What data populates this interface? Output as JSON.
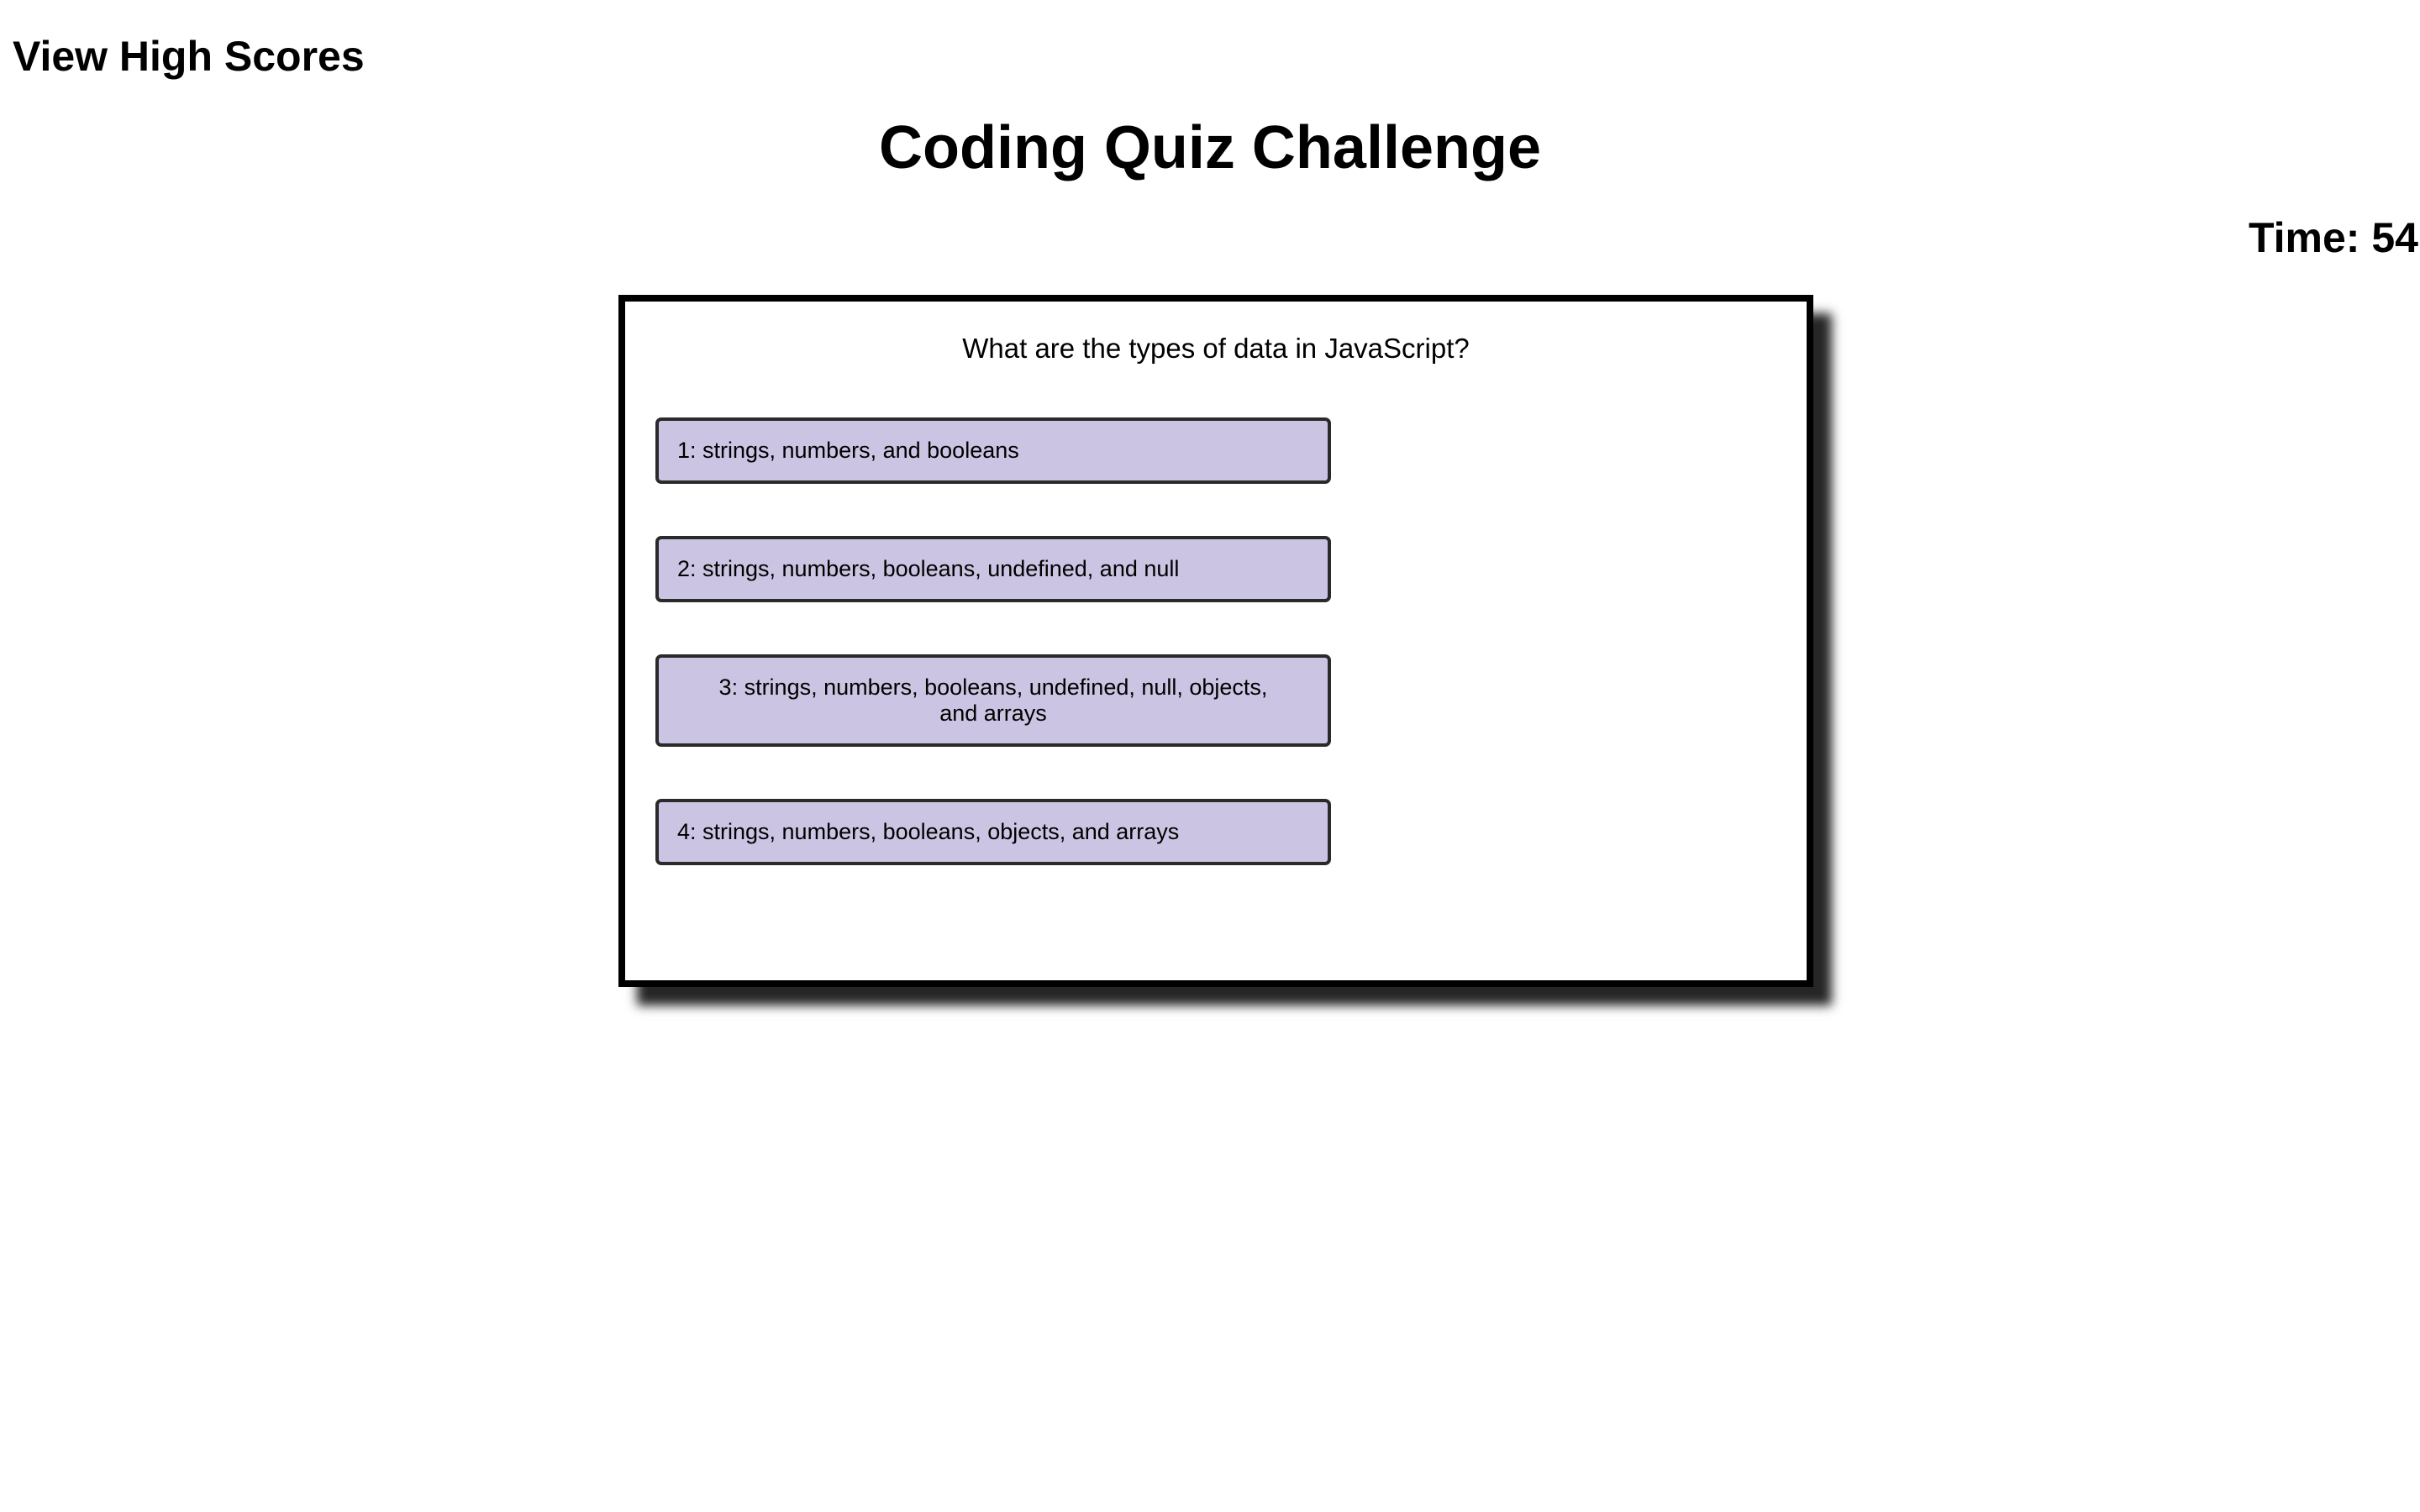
{
  "header": {
    "high_scores_label": "View High Scores",
    "title": "Coding Quiz Challenge",
    "timer_label": "Time:",
    "timer_value": "54"
  },
  "quiz": {
    "question": "What are the types of data in JavaScript?",
    "answers": [
      {
        "label": "1: strings, numbers, and booleans"
      },
      {
        "label": "2: strings, numbers, booleans, undefined, and null"
      },
      {
        "label": "3: strings, numbers, booleans, undefined, null, objects, and arrays"
      },
      {
        "label": "4: strings, numbers, booleans, objects, and arrays"
      }
    ]
  },
  "colors": {
    "answer_background": "#cbc4e2",
    "card_border": "#000000",
    "page_background": "#ffffff"
  }
}
